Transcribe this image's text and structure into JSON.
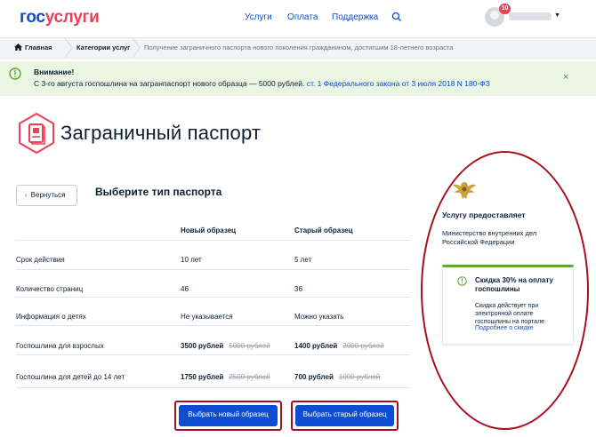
{
  "header": {
    "logo_part1": "гос",
    "logo_part2": "услуги",
    "nav": [
      "Услуги",
      "Оплата",
      "Поддержка"
    ],
    "notifications_count": "10"
  },
  "breadcrumbs": {
    "home": "Главная",
    "category": "Категории услуг",
    "current": "Получение заграничного паспорта нового поколения гражданином, достигшим 18-летнего возраста"
  },
  "alert": {
    "title": "Внимание!",
    "text": "С 3-го августа госпошлина на загранпаспорт нового образца — 5000 рублей.",
    "link": "ст. 1 Федерального закона от 3 июля 2018 N 180-ФЗ",
    "close": "×"
  },
  "page": {
    "title": "Заграничный паспорт",
    "back_label": "Вернуться",
    "section_title": "Выберите тип паспорта"
  },
  "table": {
    "headers": {
      "new": "Новый образец",
      "old": "Старый образец"
    },
    "rows": [
      {
        "label": "Срок действия",
        "new": "10 лет",
        "old": "5 лет"
      },
      {
        "label": "Количество страниц",
        "new": "46",
        "old": "36"
      },
      {
        "label": "Информация о детях",
        "new": "Не указывается",
        "old": "Можно указать"
      },
      {
        "label": "Госпошлина для взрослых",
        "new": "3500 рублей",
        "new_strike": "5000 рублей",
        "old": "1400 рублей",
        "old_strike": "2000 рублей"
      },
      {
        "label": "Госпошлина для детей до 14 лет",
        "new": "1750 рублей",
        "new_strike": "2500 рублей",
        "old": "700 рублей",
        "old_strike": "1000 рублей"
      }
    ]
  },
  "buttons": {
    "choose_new": "Выбрать новый образец",
    "choose_old": "Выбрать старый образец"
  },
  "sidebar": {
    "provider_title": "Услугу предоставляет",
    "provider_org": "Министерство внутренних дел Российской Федерации",
    "discount_title": "Скидка 30% на оплату госпошлины",
    "discount_text": "Скидка действует при электронной оплате госпошлины на портале",
    "discount_link": "Подробнее о скидке"
  },
  "colors": {
    "brand_blue": "#0d4cd3",
    "brand_red": "#ee3f58",
    "highlight_red": "#a60f1c",
    "alert_bg": "#eaf6e2",
    "success_green": "#5ea73a"
  },
  "icons": [
    "search-icon",
    "home-icon",
    "info-icon",
    "passport-icon",
    "chevron-left-icon",
    "emblem-icon",
    "close-icon",
    "caret-down-icon"
  ]
}
